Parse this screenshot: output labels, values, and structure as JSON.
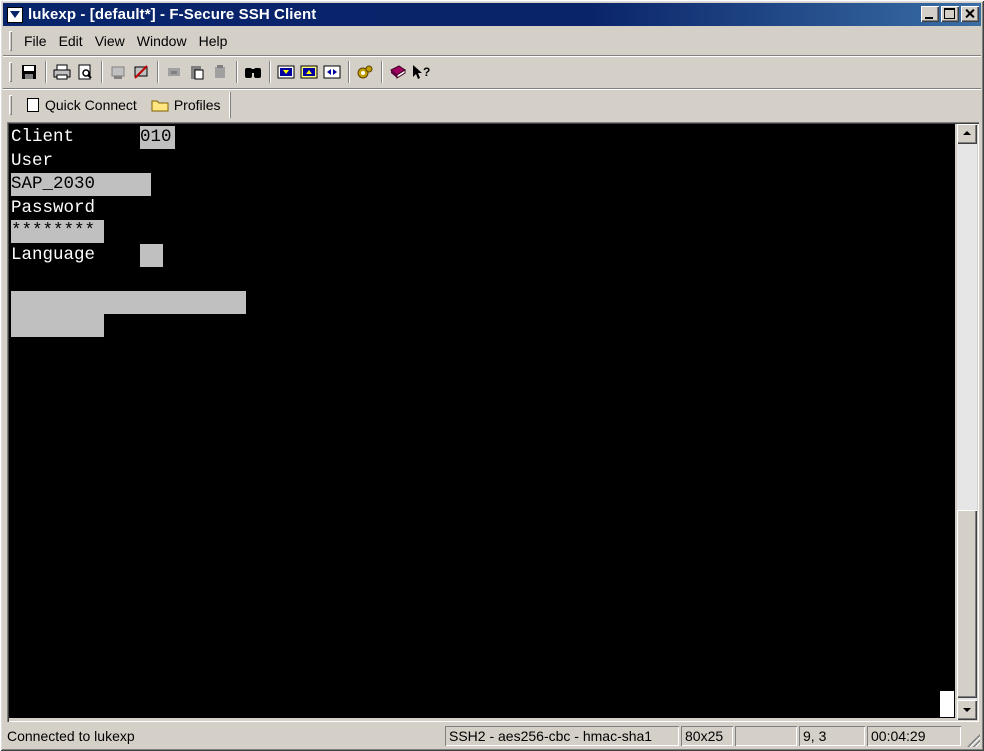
{
  "window": {
    "title": "lukexp - [default*] - F-Secure SSH Client"
  },
  "menu": {
    "items": [
      {
        "label": "File"
      },
      {
        "label": "Edit"
      },
      {
        "label": "View"
      },
      {
        "label": "Window"
      },
      {
        "label": "Help"
      }
    ]
  },
  "toolbar": {
    "icons": [
      "save-icon",
      "print-icon",
      "print-preview-icon",
      "disconnect-icon",
      "connect-icon",
      "cut-icon",
      "paste-icon",
      "copy-icon",
      "find-icon",
      "download-icon",
      "upload-icon",
      "transfer-icon",
      "settings-icon",
      "help-book-icon",
      "context-help-icon"
    ]
  },
  "quickbar": {
    "quick_connect": "Quick Connect",
    "profiles": "Profiles"
  },
  "terminal": {
    "client_label": "Client",
    "client_value": "010",
    "user_label": "User",
    "user_value": "SAP_2030",
    "password_label": "Password",
    "password_value": "********",
    "language_label": "Language",
    "language_value": ""
  },
  "status": {
    "connection": "Connected to lukexp",
    "cipher": "SSH2 - aes256-cbc - hmac-sha1",
    "size": "80x25",
    "position": "9, 3",
    "elapsed": "00:04:29"
  },
  "colors": {
    "title_bar": "#0a246a",
    "terminal_bg": "#000000",
    "terminal_fg": "#ffffff",
    "field_highlight": "#c0c0c0",
    "chrome": "#d4d0c8"
  }
}
